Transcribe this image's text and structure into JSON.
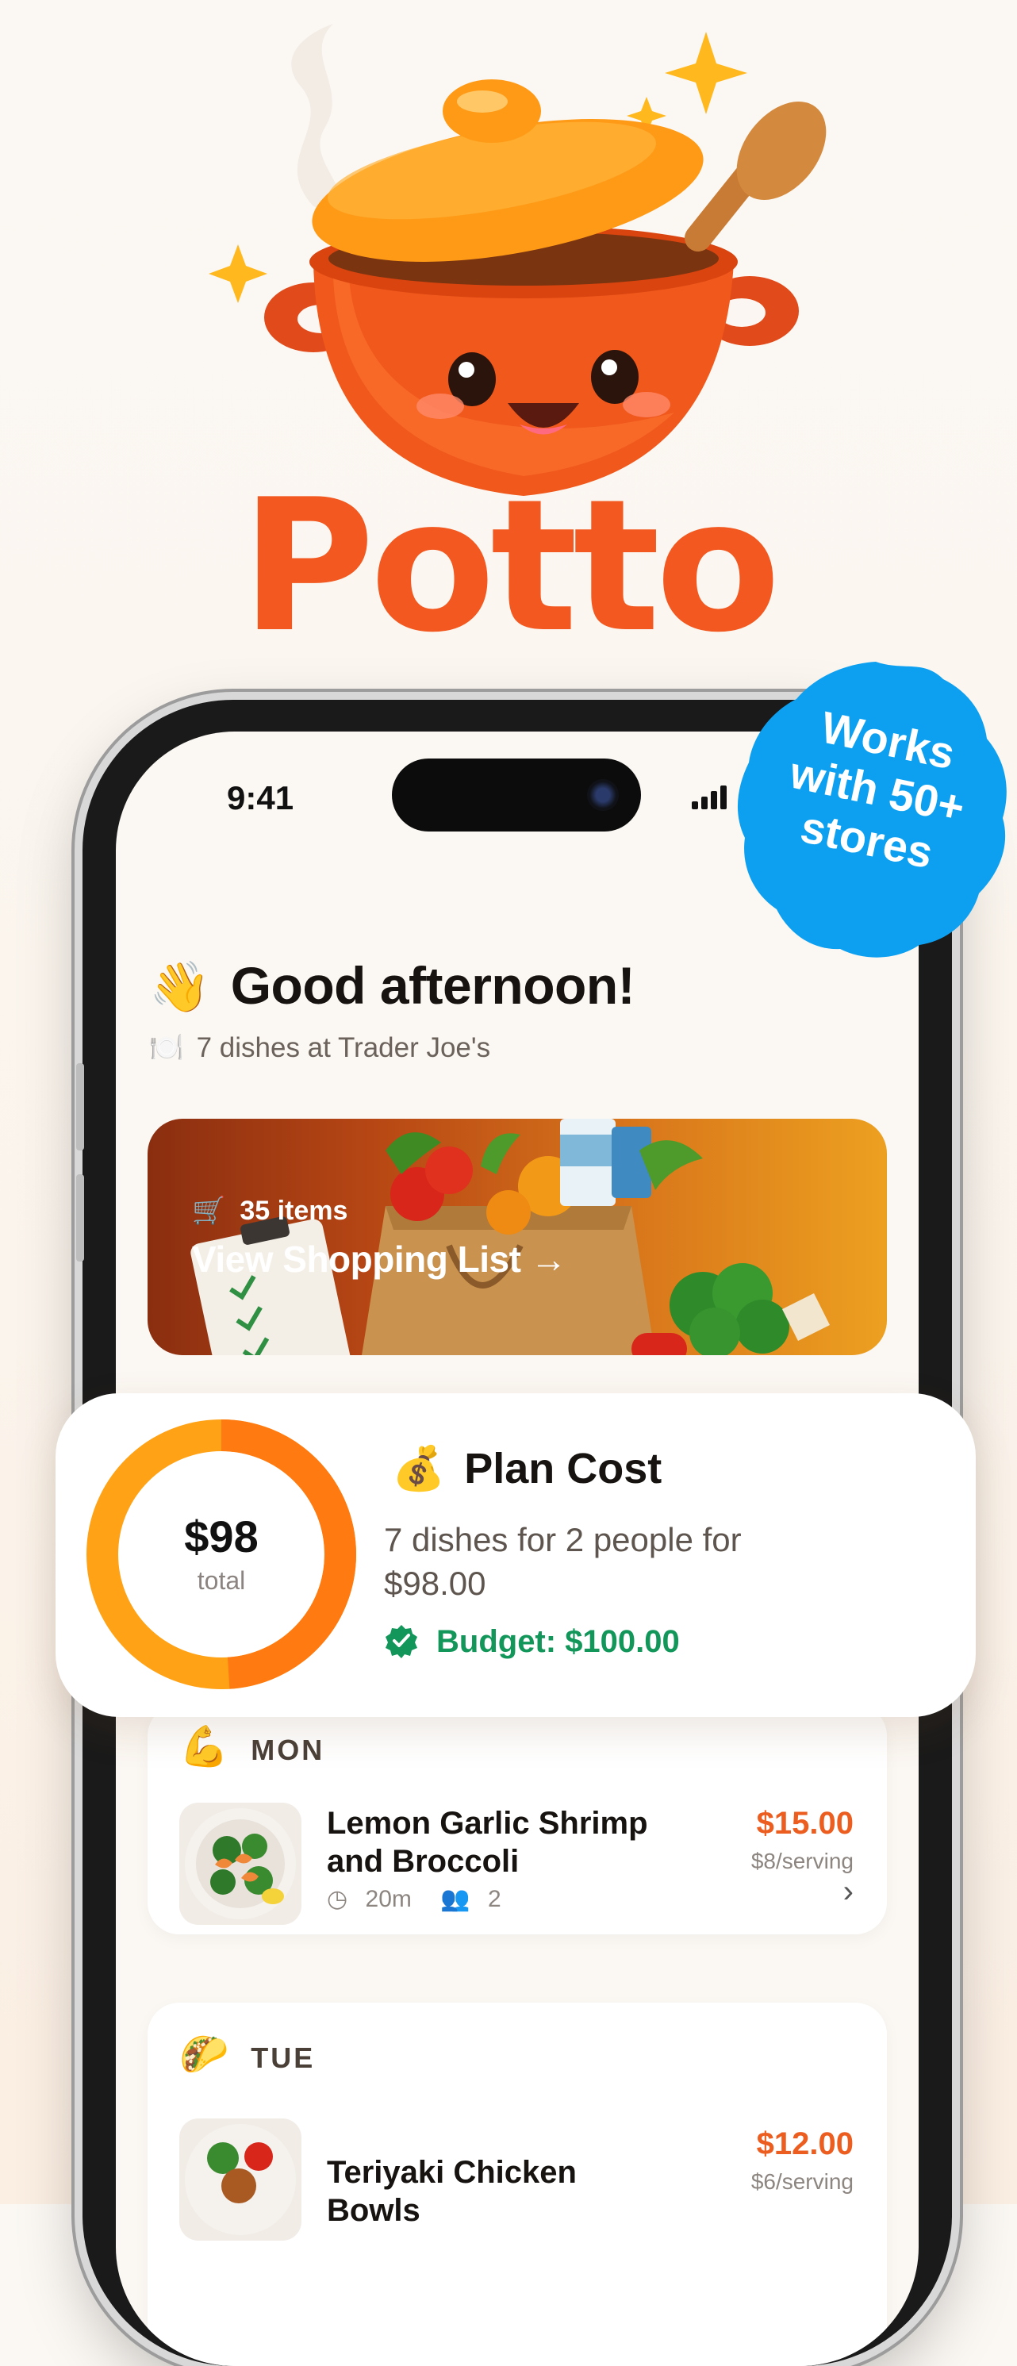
{
  "brand": {
    "name": "Potto",
    "color": "#f2581f"
  },
  "status_bar": {
    "time": "9:41"
  },
  "badge": {
    "lines": [
      "Works",
      "with 50+",
      "stores"
    ],
    "color": "#0ea0f0"
  },
  "greeting": {
    "emoji": "👋",
    "text": "Good afternoon!",
    "sub_icon": "🍽️",
    "subtitle": "7 dishes at Trader Joe's"
  },
  "shopping_banner": {
    "items": "35 items",
    "cta": "View Shopping List →"
  },
  "plan_cost": {
    "emoji": "💰",
    "title": "Plan Cost",
    "total": "$98",
    "total_label": "total",
    "description": "7 dishes for 2 people for $98.00",
    "budget": "Budget: $100.00",
    "spent_fraction": 0.98,
    "colors": {
      "primary": "#ff7a10",
      "secondary": "#ffa216",
      "budget": "#12965a"
    }
  },
  "days": [
    {
      "emoji": "💪",
      "label": "MON",
      "meal": {
        "name": "Lemon Garlic Shrimp and Broccoli",
        "price": "$15.00",
        "per_serving": "$8/serving",
        "time": "20m",
        "servings": "2"
      }
    },
    {
      "emoji": "🌮",
      "label": "TUE",
      "meal": {
        "name": "Teriyaki Chicken Bowls",
        "price": "$12.00",
        "per_serving": "$6/serving"
      }
    }
  ]
}
